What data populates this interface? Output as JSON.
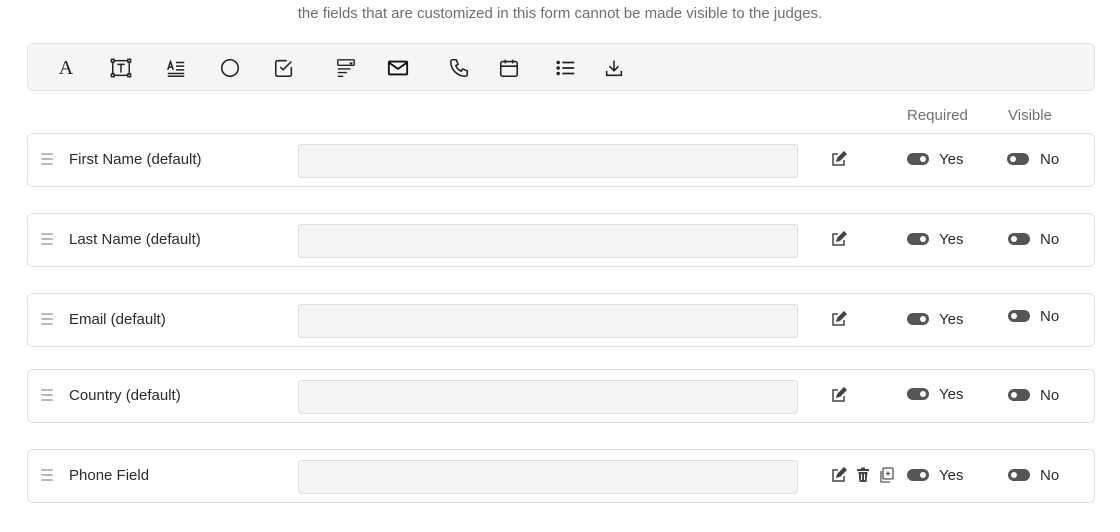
{
  "notice": "the fields that are customized in this form cannot be made visible to the judges.",
  "toolbar": {
    "tools": [
      {
        "icon": "text-icon"
      },
      {
        "icon": "text-field-icon"
      },
      {
        "icon": "paragraph-icon"
      },
      {
        "icon": "radio-icon"
      },
      {
        "icon": "checkbox-icon"
      },
      {
        "icon": "dropdown-icon"
      },
      {
        "icon": "email-icon"
      },
      {
        "icon": "phone-icon"
      },
      {
        "icon": "calendar-icon"
      },
      {
        "icon": "list-icon"
      },
      {
        "icon": "download-icon"
      }
    ],
    "text_glyph": "A"
  },
  "columns": {
    "required": "Required",
    "visible": "Visible"
  },
  "fields": [
    {
      "label": "First Name (default)",
      "required": "Yes",
      "visible": "No"
    },
    {
      "label": "Last Name (default)",
      "required": "Yes",
      "visible": "No"
    },
    {
      "label": "Email (default)",
      "required": "Yes",
      "visible": "No"
    },
    {
      "label": "Country (default)",
      "required": "Yes",
      "visible": "No"
    },
    {
      "label": "Phone Field",
      "required": "Yes",
      "visible": "No"
    }
  ],
  "colors": {
    "toggle": "#555555",
    "input_bg": "#f4f4f6",
    "toolbar_bg": "#f5f5f5"
  }
}
